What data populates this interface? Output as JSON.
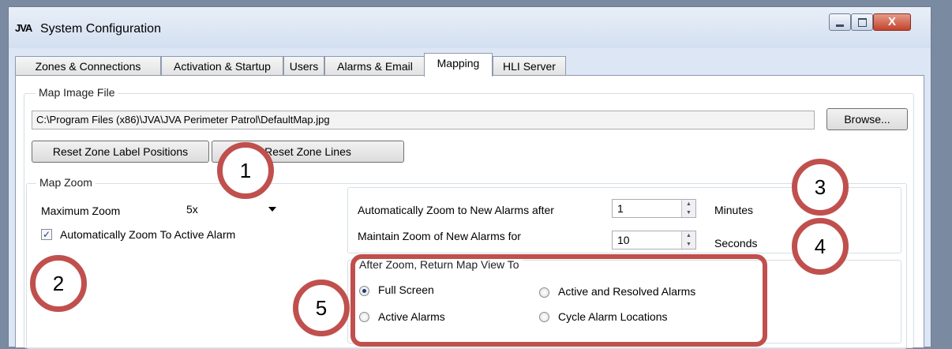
{
  "window": {
    "app_logo": "JVA",
    "title": "System Configuration",
    "controls": {
      "minimize": "minimize-icon",
      "maximize": "maximize-icon",
      "close": "close-icon",
      "close_glyph": "X"
    }
  },
  "tabs": [
    {
      "label": "Zones & Connections"
    },
    {
      "label": "Activation & Startup"
    },
    {
      "label": "Users"
    },
    {
      "label": "Alarms & Email"
    },
    {
      "label": "Mapping",
      "active": true
    },
    {
      "label": "HLI Server"
    }
  ],
  "map_image": {
    "group_label": "Map Image File",
    "path": "C:\\Program Files (x86)\\JVA\\JVA Perimeter Patrol\\DefaultMap.jpg",
    "browse_label": "Browse..."
  },
  "reset": {
    "label_positions": "Reset Zone Label Positions",
    "lines": "Reset Zone Lines"
  },
  "map_zoom": {
    "group_label": "Map Zoom",
    "max_zoom_label": "Maximum Zoom",
    "max_zoom_value": "5x",
    "auto_zoom_label": "Automatically Zoom To Active Alarm",
    "auto_zoom_checked": true,
    "check_glyph": "✓"
  },
  "zoom_settings": {
    "auto_zoom_after_label": "Automatically Zoom to New Alarms after",
    "auto_zoom_after_value": "1",
    "auto_zoom_after_unit": "Minutes",
    "maintain_label": "Maintain Zoom of New Alarms for",
    "maintain_value": "10",
    "maintain_unit": "Seconds",
    "spin_up": "▲",
    "spin_down": "▼"
  },
  "return_view": {
    "group_label": "After Zoom, Return Map View To",
    "options": [
      {
        "label": "Full Screen",
        "selected": true
      },
      {
        "label": "Active and Resolved Alarms",
        "selected": false
      },
      {
        "label": "Active Alarms",
        "selected": false
      },
      {
        "label": "Cycle Alarm Locations",
        "selected": false
      }
    ]
  },
  "callouts": [
    "1",
    "2",
    "3",
    "4",
    "5"
  ],
  "colors": {
    "callout": "#c0504d",
    "title_bg": "#dce6f4",
    "close": "#c4432b"
  }
}
